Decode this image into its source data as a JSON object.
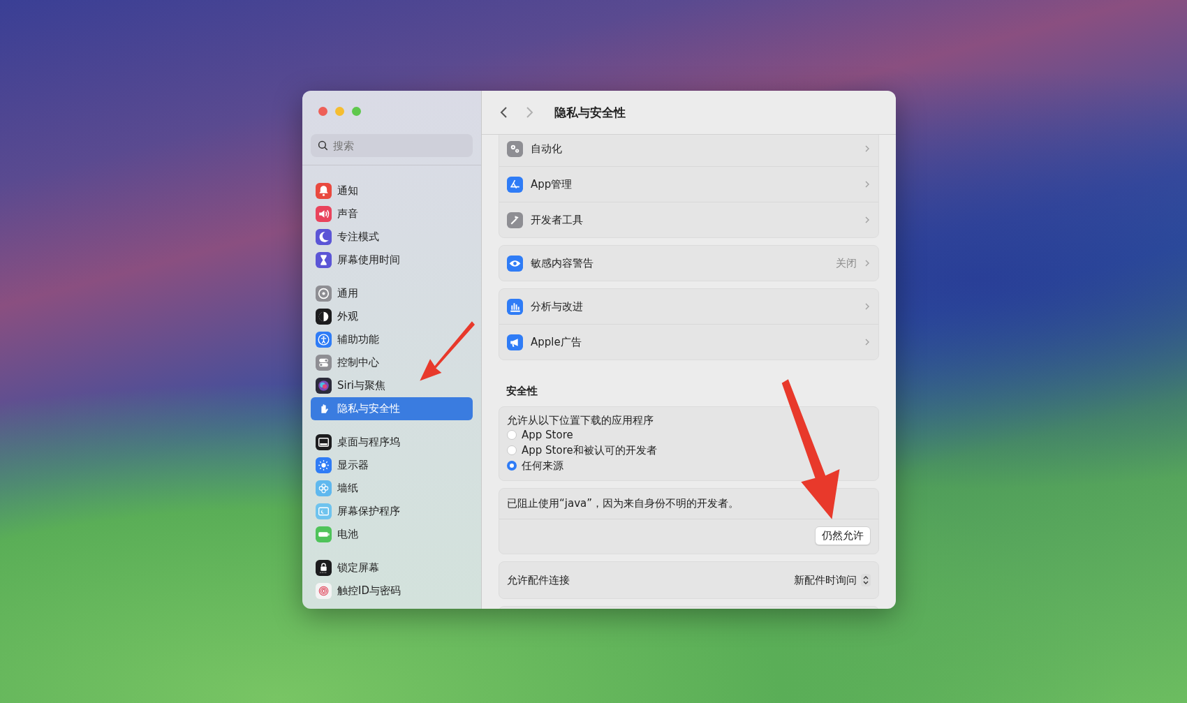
{
  "window": {
    "title": "隐私与安全性"
  },
  "navigation": {
    "back": {
      "disabled": false
    },
    "forward": {
      "disabled": true
    }
  },
  "search": {
    "placeholder": "搜索"
  },
  "sidebar": {
    "groups": [
      {
        "items": [
          {
            "label": "通知",
            "selected": false
          },
          {
            "label": "声音",
            "selected": false
          },
          {
            "label": "专注模式",
            "selected": false
          },
          {
            "label": "屏幕使用时间",
            "selected": false
          }
        ]
      },
      {
        "items": [
          {
            "label": "通用",
            "selected": false
          },
          {
            "label": "外观",
            "selected": false
          },
          {
            "label": "辅助功能",
            "selected": false
          },
          {
            "label": "控制中心",
            "selected": false
          },
          {
            "label": "Siri与聚焦",
            "selected": false
          },
          {
            "label": "隐私与安全性",
            "selected": true
          }
        ]
      },
      {
        "items": [
          {
            "label": "桌面与程序坞",
            "selected": false
          },
          {
            "label": "显示器",
            "selected": false
          },
          {
            "label": "墙纸",
            "selected": false
          },
          {
            "label": "屏幕保护程序",
            "selected": false
          },
          {
            "label": "电池",
            "selected": false
          }
        ]
      },
      {
        "items": [
          {
            "label": "锁定屏幕",
            "selected": false
          },
          {
            "label": "触控ID与密码",
            "selected": false
          }
        ]
      }
    ]
  },
  "settings_groups": [
    {
      "rows": [
        {
          "label": "自动化"
        },
        {
          "label": "App管理"
        },
        {
          "label": "开发者工具"
        }
      ]
    },
    {
      "rows": [
        {
          "label": "敏感内容警告",
          "value": "关闭"
        }
      ]
    },
    {
      "rows": [
        {
          "label": "分析与改进"
        },
        {
          "label": "Apple广告"
        }
      ]
    }
  ],
  "security": {
    "heading": "安全性",
    "sources": {
      "label": "允许从以下位置下载的应用程序",
      "options": [
        {
          "label": "App Store",
          "selected": false
        },
        {
          "label": "App Store和被认可的开发者",
          "selected": false
        },
        {
          "label": "任何来源",
          "selected": true
        }
      ]
    },
    "blocked_notice": {
      "message": "已阻止使用“java”，因为来自身份不明的开发者。",
      "button": "仍然允许"
    },
    "accessories": {
      "label": "允许配件连接",
      "value": "新配件时询问"
    }
  }
}
